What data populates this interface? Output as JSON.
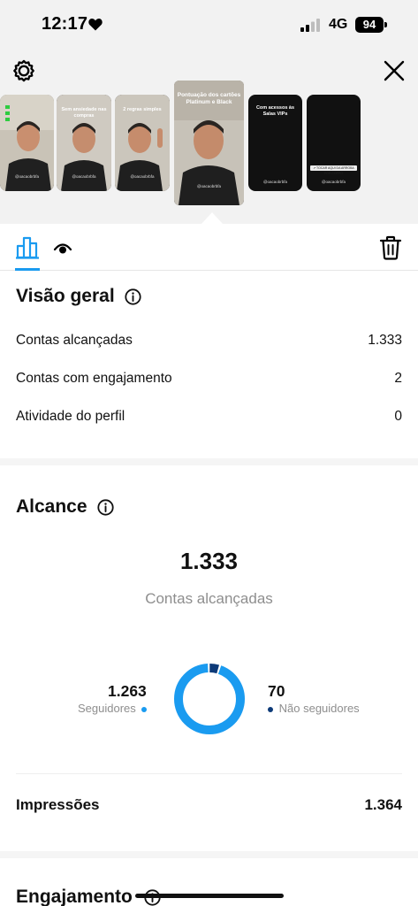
{
  "status_bar": {
    "time": "12:17",
    "network": "4G",
    "battery": "94"
  },
  "stories": [
    {
      "caption": "",
      "handle": "@oacaobrbfa"
    },
    {
      "caption": "Sem ansiedade nas compras",
      "handle": "@oacaobrbfa"
    },
    {
      "caption": "2 regras simples",
      "handle": "@oacaobrbfa"
    },
    {
      "caption": "Pontuação dos cartões Platinum e Black",
      "handle": "@oacaobrbfa"
    },
    {
      "caption": "Com acessos às Salas VIPs",
      "handle": "@oacaobrbfa"
    },
    {
      "caption": "",
      "handle": "@oacaobrbfa",
      "link_label": "↗ TOCAR AQUI DA ARROBA FOR COPPO"
    }
  ],
  "overview": {
    "title": "Visão geral",
    "rows": [
      {
        "label": "Contas alcançadas",
        "value": "1.333"
      },
      {
        "label": "Contas com engajamento",
        "value": "2"
      },
      {
        "label": "Atividade do perfil",
        "value": "0"
      }
    ]
  },
  "reach": {
    "title": "Alcance",
    "total": "1.333",
    "total_label": "Contas alcançadas",
    "followers_value": "1.263",
    "followers_label": "Seguidores",
    "non_followers_value": "70",
    "non_followers_label": "Não seguidores",
    "followers_count": 1263,
    "non_followers_count": 70,
    "followers_color": "#1a9bf0",
    "non_followers_color": "#0d3a78",
    "impressions_label": "Impressões",
    "impressions_value": "1.364"
  },
  "engagement": {
    "title": "Engajamento"
  },
  "colors": {
    "accent": "#1a9bf0",
    "muted_text": "#8e8e8e",
    "top_background": "#f2f2f2"
  }
}
